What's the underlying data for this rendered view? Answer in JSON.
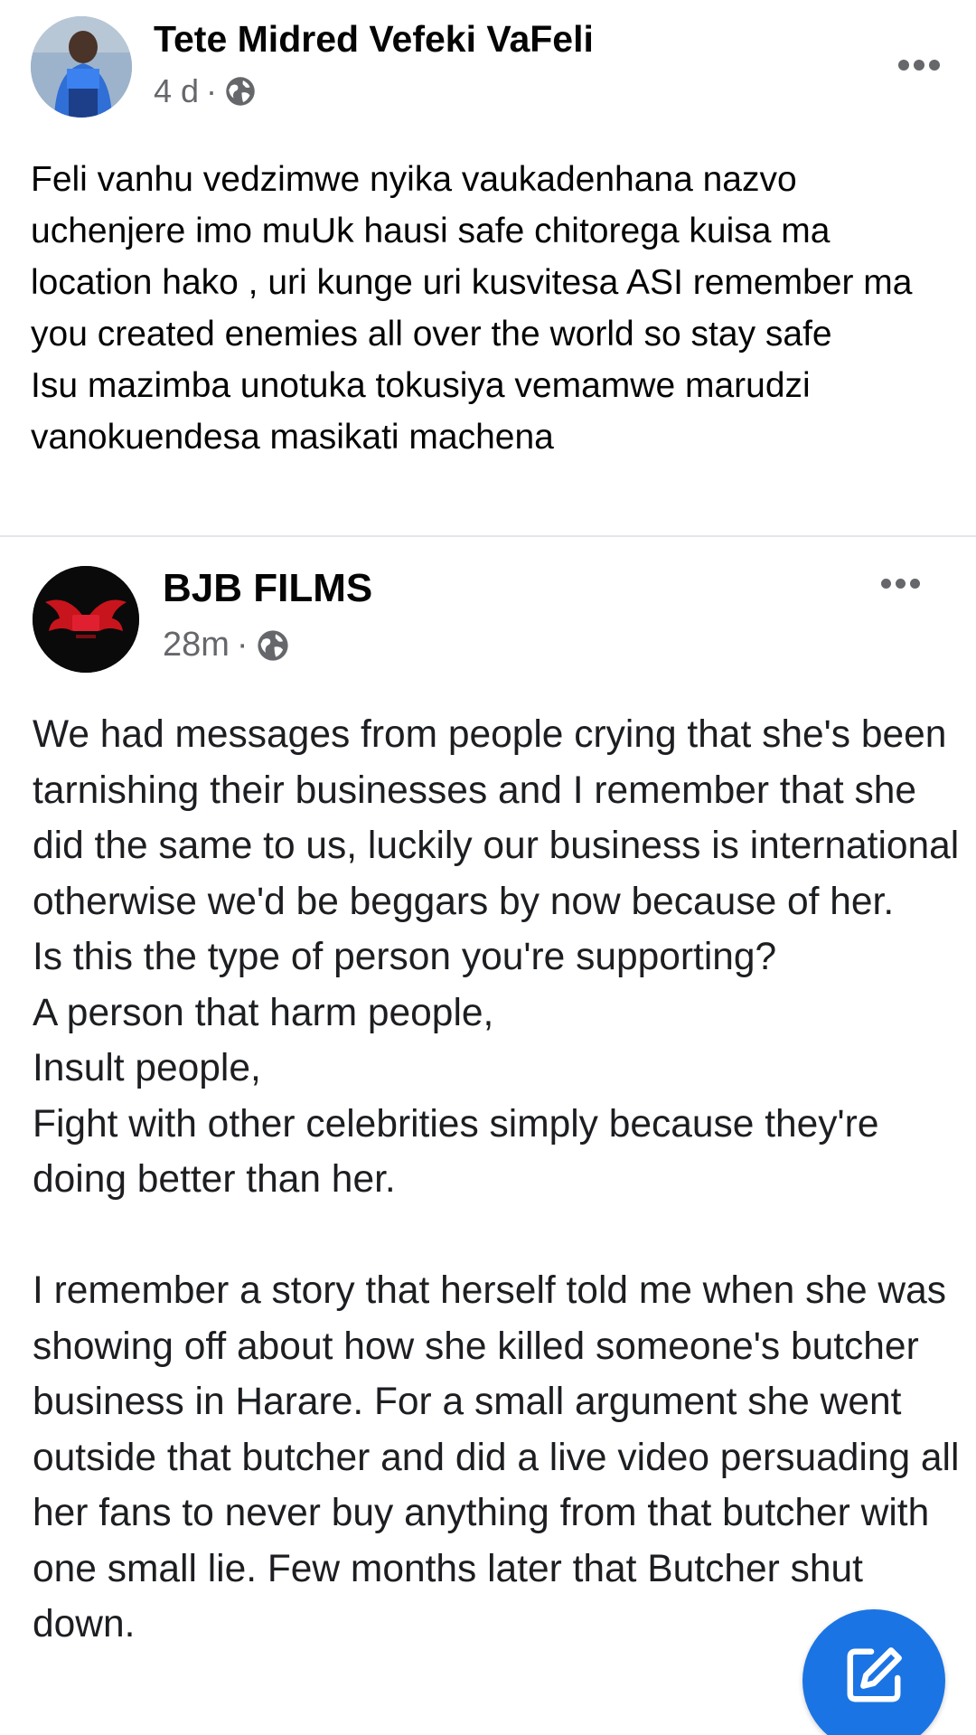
{
  "post1": {
    "author": "Tete Midred Vefeki VaFeli",
    "time": "4 d",
    "separator": "·",
    "audience_icon": "globe-icon",
    "menu_icon": "more-horizontal-icon",
    "lines": [
      "Feli vanhu vedzimwe nyika vaukadenhana nazvo uchenjere imo muUk hausi safe chitorega kuisa ma location hako , uri kunge uri kusvitesa ASI remember ma you created enemies all over the world so stay safe",
      "Isu mazimba unotuka tokusiya vemamwe marudzi vanokuendesa masikati machena"
    ]
  },
  "post2": {
    "author": "BJB FILMS",
    "time": "28m",
    "separator": "·",
    "audience_icon": "globe-icon",
    "menu_icon": "more-horizontal-icon",
    "paragraphs": [
      "We had messages from people crying that she's been tarnishing their businesses and I remember that she did the same to us, luckily our business is international otherwise we'd be beggars by now because of her.",
      "Is this the type of person you're supporting?",
      "A person that harm people,",
      "Insult people,",
      "Fight with other celebrities simply because they're doing better than her.",
      "I remember a story that herself told me when she was showing off about how she killed someone's butcher business in Harare. For a small argument she went outside that butcher and did a live video persuading all her fans to never buy anything from that butcher with one small lie. Few months later that Butcher shut down."
    ]
  },
  "fab": {
    "icon": "compose-icon"
  },
  "colors": {
    "fab": "#1b74e4",
    "meta": "#65676b",
    "divider": "#e4e6eb"
  }
}
